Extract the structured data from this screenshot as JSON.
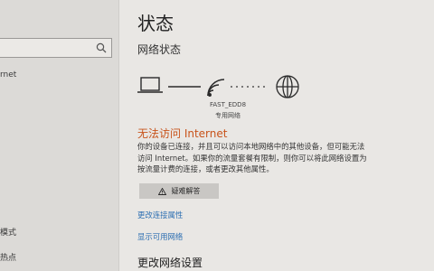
{
  "sidebar": {
    "items": [
      {
        "label": "rnet"
      },
      {
        "label": "模式"
      },
      {
        "label": "热点"
      }
    ]
  },
  "main": {
    "title": "状态",
    "section_title": "网络状态",
    "network": {
      "name": "FAST_EDD8",
      "type": "专用网络"
    },
    "status_heading": "无法访问 Internet",
    "description": "你的设备已连接，并且可以访问本地网络中的其他设备，但可能无法访问 Internet。如果你的流量套餐有限制，则你可以将此网络设置为按流量计费的连接，或者更改其他属性。",
    "troubleshoot_label": "疑难解答",
    "links": {
      "change_properties": "更改连接属性",
      "show_networks": "显示可用网络"
    },
    "change_settings_heading": "更改网络设置"
  },
  "colors": {
    "status_warning": "#c8531a",
    "link": "#2d6fb2"
  },
  "icons": [
    "search-icon",
    "laptop-icon",
    "wifi-icon",
    "globe-icon",
    "warning-icon"
  ]
}
